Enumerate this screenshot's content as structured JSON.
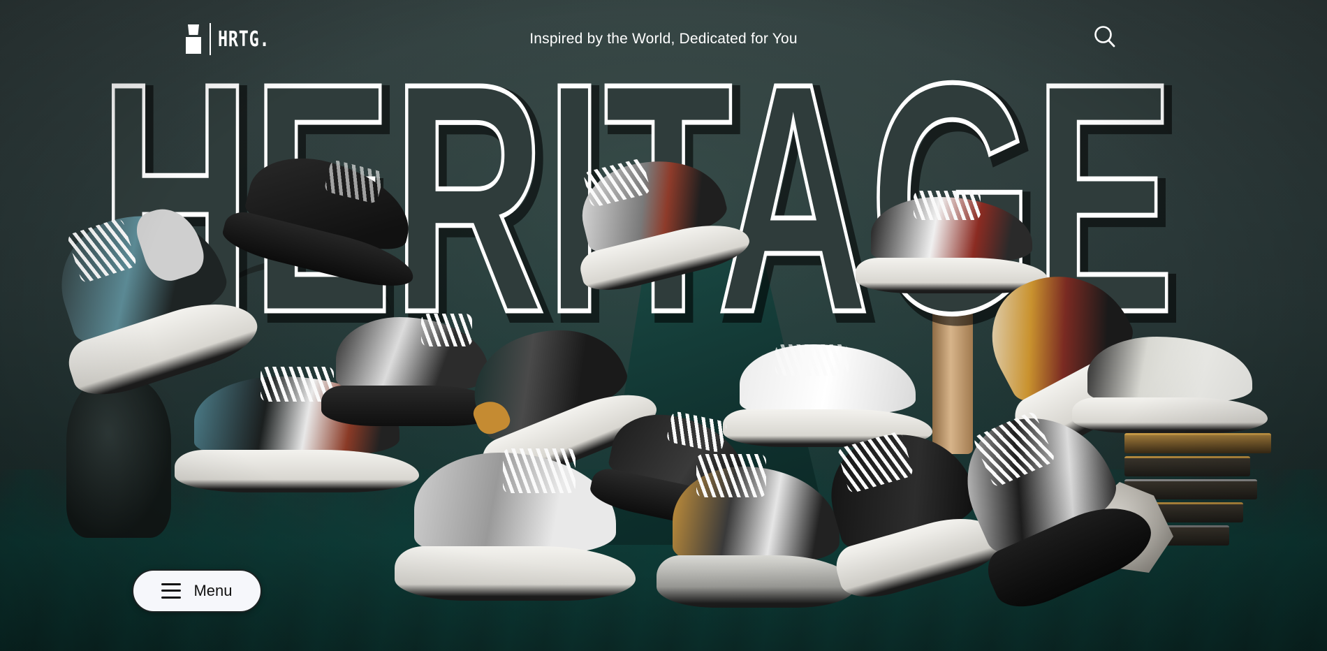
{
  "brand": {
    "logo_text": "HRTG.",
    "hero_word": "HERITAGE"
  },
  "header": {
    "tagline": "Inspired by the World, Dedicated for You",
    "search_icon": "search-icon"
  },
  "menu": {
    "label": "Menu",
    "icon": "hamburger-icon"
  },
  "colors": {
    "background": "#2f3a3a",
    "text": "#ffffff",
    "menu_bg": "#f6f7fb",
    "accent_teal": "#0f3a36"
  }
}
